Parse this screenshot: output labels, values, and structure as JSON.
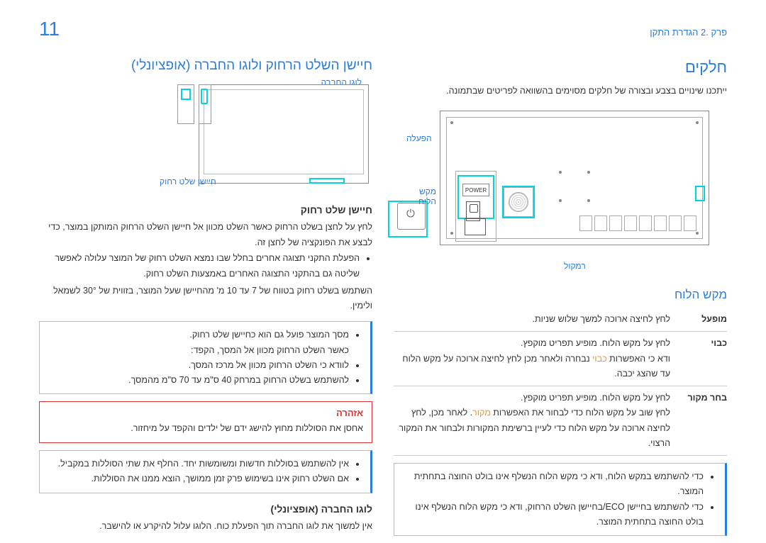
{
  "header": {
    "chapter": "פרק .2 הגדרת התקן",
    "page_number": "11"
  },
  "right_col": {
    "title": "חלקים",
    "intro": "ייתכנו שינויים בצבע ובצורה של חלקים מסוימים בהשוואה לפריטים שבתמונה.",
    "diagram_labels": {
      "power_on": "הפעלה",
      "power_text": "POWER",
      "speaker": "רמקול",
      "panel_button": "מקש הלוח"
    },
    "panel_button_title": "מקש הלוח",
    "table": {
      "row1_term": "מופעל",
      "row1_desc": "לחץ לחיצה ארוכה למשך שלוש שניות.",
      "row2_term": "כבוי",
      "row2_desc_a": "לחץ על מקש הלוח. מופיע תפריט מוקפץ.",
      "row2_desc_b_pre": "ודא כי האפשרות ",
      "row2_desc_b_word": "כבוי",
      "row2_desc_b_post": " נבחרה ולאחר מכן לחץ לחיצה ארוכה על מקש הלוח עד שהצג יכבה.",
      "row3_term": "בחר מקור",
      "row3_desc_a": "לחץ על מקש הלוח. מופיע תפריט מוקפץ.",
      "row3_desc_b_pre": "לחץ שוב על מקש הלוח כדי לבחור את האפשרות ",
      "row3_desc_b_word": "מקור",
      "row3_desc_b_post": " לאחר מכן, לחץ לחיצה ארוכה על מקש הלוח כדי לעיין ברשימת המקורות ולבחור את המקור הרצוי."
    },
    "info_bullets": [
      "כדי להשתמש במקש הלוח, ודא כי מקש הלוח הנשלף אינו בולט החוצה בתחתית המוצר.",
      "כדי להשתמש בחיישן ECO/בחיישן השלט הרחוק, ודא כי מקש הלוח הנשלף אינו בולט החוצה בתחתית המוצר."
    ]
  },
  "left_col": {
    "title": "חיישן השלט הרחוק ולוגו החברה (אופציונלי)",
    "diagram_labels": {
      "company_logo": "לוגו החברה",
      "remote_sensor": "חיישן שלט רחוק"
    },
    "sensor_heading": "חיישן שלט רחוק",
    "sensor_p1": "לחץ על לחצן בשלט הרחוק כאשר השלט מכוון אל חיישן השלט הרחוק המותקן במוצר, כדי לבצע את הפונקציה של לחצן זה.",
    "sensor_bullets": [
      "הפעלת התקני תצוגה אחרים בחלל שבו נמצא השלט רחוק של המוצר עלולה לאפשר שליטה גם בהתקני התצוגה האחרים באמצעות השלט רחוק."
    ],
    "sensor_p2": "השתמש בשלט רחוק בטווח של 7 עד 10 מ' מהחיישן שעל המוצר, בזווית של 30° לשמאל ולימין.",
    "pre_warning_bullets": [
      "מסך המוצר פועל גם הוא כחיישן שלט רחוק.\nכאשר השלט הרחוק מכוון אל המסך, הקפד:",
      "לוודא כי השלט הרחוק מכוון אל מרכז המסך.",
      "להשתמש בשלט הרחוק במרחק 40 ס\"מ עד 70 ס\"מ מהמסך."
    ],
    "warning_title": "אזהרה",
    "warning_text": "אחסן את הסוללות מחוץ להישג ידם של ילדים והקפד על מיחזור.",
    "info_bullets": [
      "אין להשתמש בסוללות חדשות ומשומשות יחד. החלף את שתי הסוללות במקביל.",
      "אם השלט רחוק אינו בשימוש פרק זמן ממושך, הוצא ממנו את הסוללות."
    ],
    "logo_heading": "לוגו החברה (אופציונלי)",
    "logo_text": "אין למשוך את לוגו החברה תוך הפעלת כוח. הלוגו עלול להיקרע או להישבר."
  }
}
